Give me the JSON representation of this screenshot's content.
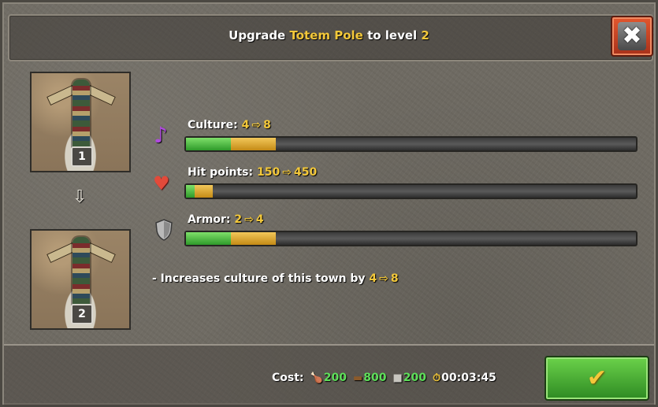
{
  "header": {
    "title_prefix": "Upgrade",
    "building_name": "Totem Pole",
    "title_middle": "to level",
    "target_level": "2"
  },
  "close_button": {
    "icon": "close-icon"
  },
  "levels": {
    "from_badge": "1",
    "to_badge": "2"
  },
  "stats": [
    {
      "icon": "music-note-icon",
      "label": "Culture:",
      "from": "4",
      "to": "8",
      "current_fraction": 0.1,
      "upgraded_fraction": 0.2
    },
    {
      "icon": "heart-icon",
      "label": "Hit points:",
      "from": "150",
      "to": "450",
      "current_fraction": 0.02,
      "upgraded_fraction": 0.06
    },
    {
      "icon": "shield-icon",
      "label": "Armor:",
      "from": "2",
      "to": "4",
      "current_fraction": 0.1,
      "upgraded_fraction": 0.2
    }
  ],
  "description": {
    "text": "- Increases culture of this town by",
    "from": "4",
    "to": "8"
  },
  "cost": {
    "label": "Cost:",
    "food": "200",
    "wood": "800",
    "stone": "200",
    "time": "00:03:45"
  },
  "colors": {
    "highlight": "#f3c83a",
    "resource_green": "#5ee05a",
    "bar_current": "#2f9a2a",
    "bar_upgrade": "#c48a16"
  }
}
